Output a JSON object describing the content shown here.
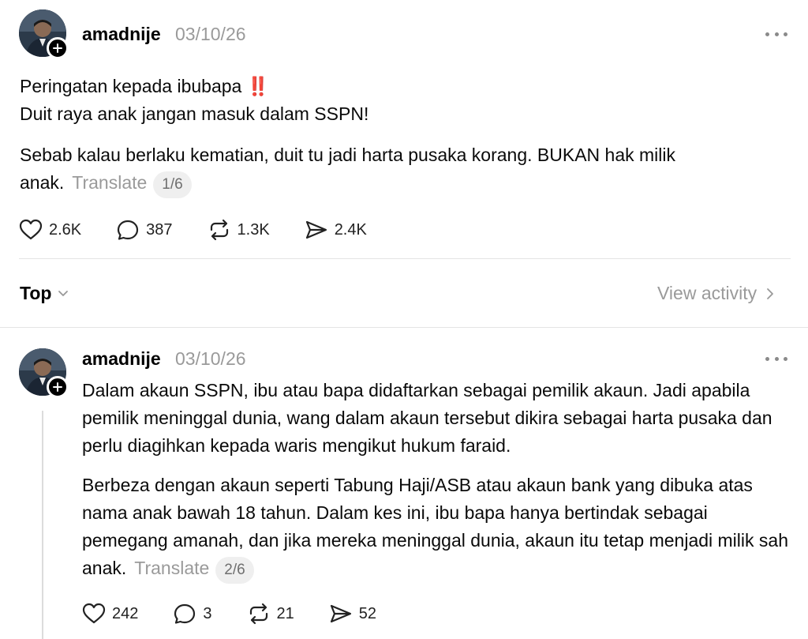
{
  "post": {
    "username": "amadnije",
    "date": "03/10/26",
    "line1": "Peringatan kepada ibubapa",
    "emoji": "‼️",
    "line2": "Duit raya anak jangan masuk dalam SSPN!",
    "para2": "Sebab kalau berlaku kematian, duit tu jadi harta pusaka korang. BUKAN hak milik anak.",
    "translate_label": "Translate",
    "pager": "1/6",
    "likes": "2.6K",
    "comments": "387",
    "reposts": "1.3K",
    "shares": "2.4K"
  },
  "filter": {
    "sort_label": "Top",
    "view_activity_label": "View activity"
  },
  "reply": {
    "username": "amadnije",
    "date": "03/10/26",
    "para1": "Dalam akaun SSPN, ibu atau bapa didaftarkan sebagai pemilik akaun. Jadi apabila pemilik meninggal dunia, wang dalam akaun tersebut dikira sebagai harta pusaka dan perlu diagihkan kepada waris mengikut hukum faraid.",
    "para2": "Berbeza dengan akaun seperti Tabung Haji/ASB atau akaun bank yang dibuka atas nama anak bawah 18 tahun. Dalam kes ini, ibu bapa hanya bertindak sebagai pemegang amanah, dan jika mereka meninggal dunia, akaun itu tetap menjadi milik sah anak.",
    "translate_label": "Translate",
    "pager": "2/6",
    "likes": "242",
    "comments": "3",
    "reposts": "21",
    "shares": "52"
  }
}
